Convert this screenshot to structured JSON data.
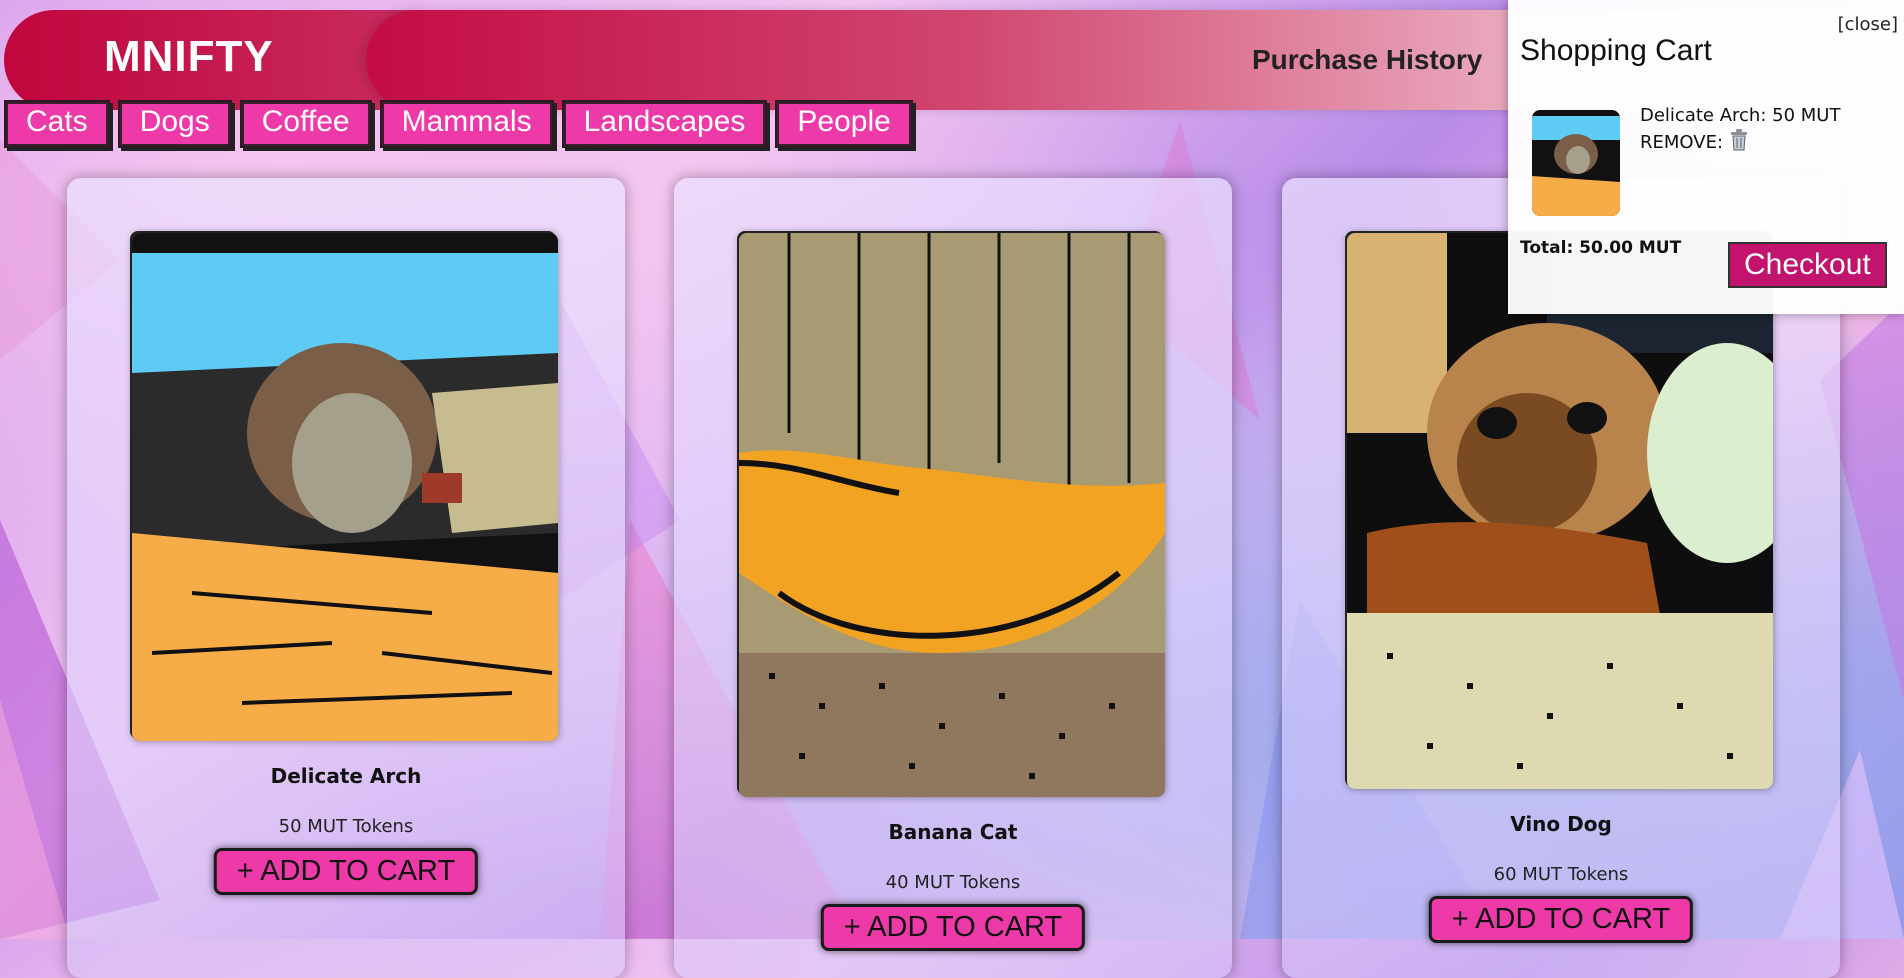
{
  "app": {
    "logo": "MNIFTY"
  },
  "header": {
    "purchase_history": "Purchase History"
  },
  "categories": [
    "Cats",
    "Dogs",
    "Coffee",
    "Mammals",
    "Landscapes",
    "People"
  ],
  "products": [
    {
      "name": "Delicate Arch",
      "price": "50 MUT Tokens",
      "add_label": "+ ADD TO CART"
    },
    {
      "name": "Banana Cat",
      "price": "40 MUT Tokens",
      "add_label": "+ ADD TO CART"
    },
    {
      "name": "Vino Dog",
      "price": "60 MUT Tokens",
      "add_label": "+ ADD TO CART"
    }
  ],
  "cart": {
    "close": "[close]",
    "title": "Shopping Cart",
    "item_text": "Delicate Arch: 50 MUT",
    "remove_label": "REMOVE:",
    "total": "Total: 50.00 MUT",
    "checkout": "Checkout"
  },
  "colors": {
    "brand": "#c0063d",
    "accent_pink": "#ed3aa8",
    "checkout": "#c2136e"
  },
  "icons": [
    "trash-icon"
  ]
}
